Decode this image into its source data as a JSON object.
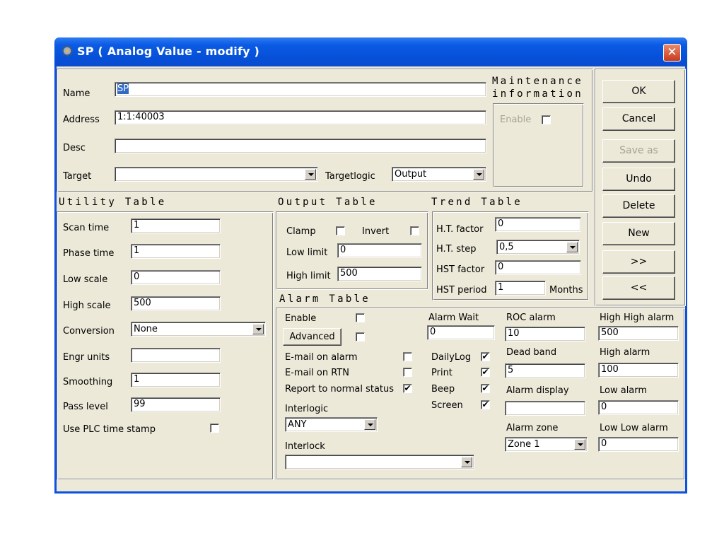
{
  "window": {
    "title": "SP  ( Analog Value - modify )",
    "close_symbol": "✕",
    "icon": "gear-icon"
  },
  "general": {
    "name_label": "Name",
    "name_value": "SP",
    "address_label": "Address",
    "address_value": "1:1:40003",
    "desc_label": "Desc",
    "desc_value": "",
    "target_label": "Target",
    "target_value": "",
    "targetlogic_label": "Targetlogic",
    "targetlogic_value": "Output"
  },
  "maintenance": {
    "title_line1": "Maintenance",
    "title_line2": "information",
    "enable_label": "Enable",
    "enable_checked": false
  },
  "buttons": {
    "ok": "OK",
    "cancel": "Cancel",
    "save_as": "Save as",
    "undo": "Undo",
    "delete": "Delete",
    "new": "New",
    "next": ">>",
    "prev": "<<"
  },
  "utility": {
    "title": "Utility Table",
    "scan_time_label": "Scan time",
    "scan_time": "1",
    "phase_time_label": "Phase time",
    "phase_time": "1",
    "low_scale_label": "Low scale",
    "low_scale": "0",
    "high_scale_label": "High scale",
    "high_scale": "500",
    "conversion_label": "Conversion",
    "conversion": "None",
    "engr_units_label": "Engr units",
    "engr_units": "",
    "smoothing_label": "Smoothing",
    "smoothing": "1",
    "pass_level_label": "Pass level",
    "pass_level": "99",
    "use_plc_label": "Use PLC time stamp",
    "use_plc_checked": false
  },
  "output": {
    "title": "Output Table",
    "clamp_label": "Clamp",
    "clamp_checked": false,
    "invert_label": "Invert",
    "invert_checked": false,
    "low_limit_label": "Low limit",
    "low_limit": "0",
    "high_limit_label": "High limit",
    "high_limit": "500"
  },
  "trend": {
    "title": "Trend Table",
    "ht_factor_label": "H.T. factor",
    "ht_factor": "0",
    "ht_step_label": "H.T. step",
    "ht_step": "0,5",
    "hst_factor_label": "HST factor",
    "hst_factor": "0",
    "hst_period_label": "HST period",
    "hst_period": "1",
    "months_label": "Months"
  },
  "alarm": {
    "title": "Alarm Table",
    "enable_label": "Enable",
    "enable_checked": false,
    "advanced_label": "Advanced",
    "advanced_checked": false,
    "email_alarm_label": "E-mail on alarm",
    "email_alarm_checked": false,
    "email_rtn_label": "E-mail on RTN",
    "email_rtn_checked": false,
    "report_label": "Report to normal status",
    "report_checked": true,
    "interlogic_label": "Interlogic",
    "interlogic_value": "ANY",
    "interlock_label": "Interlock",
    "interlock_value": "",
    "alarm_wait_label": "Alarm Wait",
    "alarm_wait": "0",
    "dailylog_label": "DailyLog",
    "dailylog_checked": true,
    "print_label": "Print",
    "print_checked": true,
    "beep_label": "Beep",
    "beep_checked": true,
    "screen_label": "Screen",
    "screen_checked": true,
    "roc_label": "ROC alarm",
    "roc": "10",
    "deadband_label": "Dead band",
    "deadband": "5",
    "display_label": "Alarm display",
    "display": "",
    "zone_label": "Alarm zone",
    "zone": "Zone 1",
    "hh_label": "High High alarm",
    "hh": "500",
    "high_label": "High alarm",
    "high": "100",
    "low_label": "Low alarm",
    "low": "0",
    "ll_label": "Low Low alarm",
    "ll": "0"
  },
  "colors": {
    "title_bar": "#0a52df",
    "dialog_face": "#ece9d8",
    "close_button": "#c93a1a"
  }
}
